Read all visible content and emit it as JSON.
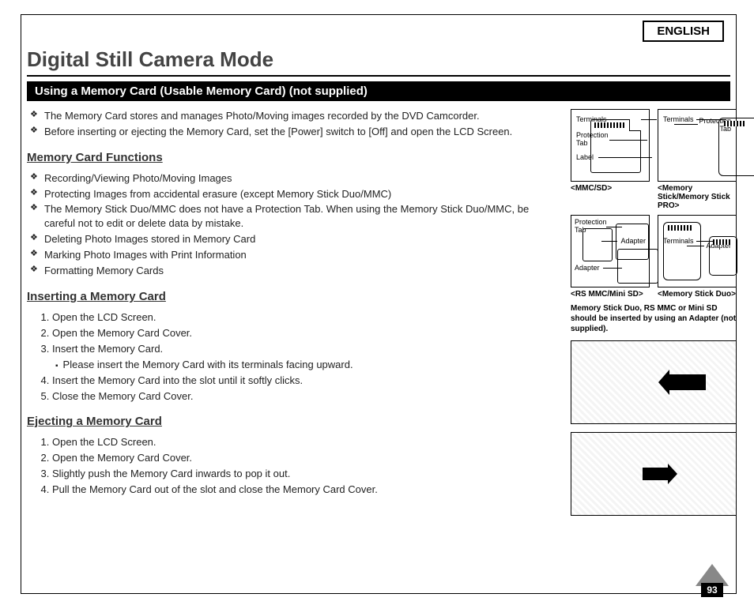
{
  "language_label": "ENGLISH",
  "title": "Digital Still Camera Mode",
  "section_bar": "Using a Memory Card (Usable Memory Card) (not supplied)",
  "intro": [
    "The Memory Card stores and manages Photo/Moving images recorded by the DVD Camcorder.",
    "Before inserting or ejecting the Memory Card, set the [Power] switch to [Off] and open the LCD Screen."
  ],
  "functions_head": "Memory Card Functions",
  "functions": [
    "Recording/Viewing Photo/Moving Images",
    "Protecting Images from accidental erasure (except Memory Stick Duo/MMC)",
    "The Memory Stick Duo/MMC does not have a Protection Tab. When using the Memory Stick Duo/MMC, be careful not to edit or delete data by mistake.",
    "Deleting Photo Images stored in Memory Card",
    "Marking Photo Images with Print Information",
    "Formatting Memory Cards"
  ],
  "insert_head": "Inserting a Memory Card",
  "insert_steps": [
    "Open the LCD Screen.",
    "Open the Memory Card Cover.",
    "Insert the Memory Card."
  ],
  "insert_sub": "Please insert the Memory Card with its terminals facing upward.",
  "insert_steps_cont": [
    "Insert the Memory Card into the slot until it softly clicks.",
    "Close the Memory Card Cover."
  ],
  "eject_head": "Ejecting a Memory Card",
  "eject_steps": [
    "Open the LCD Screen.",
    "Open the Memory Card Cover.",
    "Slightly push the Memory Card inwards to pop it out.",
    "Pull the Memory Card out of the slot and close the Memory Card Cover."
  ],
  "cards": {
    "mmc_sd": "<MMC/SD>",
    "ms_pro": "<Memory Stick/Memory Stick PRO>",
    "rs_mini": "<RS MMC/Mini SD>",
    "ms_duo": "<Memory Stick Duo>"
  },
  "callouts": {
    "terminals": "Terminals",
    "protection_tab": "Protection Tab",
    "label": "Label",
    "adapter": "Adapter"
  },
  "adapter_note": "Memory Stick Duo, RS MMC or Mini SD should be inserted by using an Adapter (not supplied).",
  "page_number": "93"
}
